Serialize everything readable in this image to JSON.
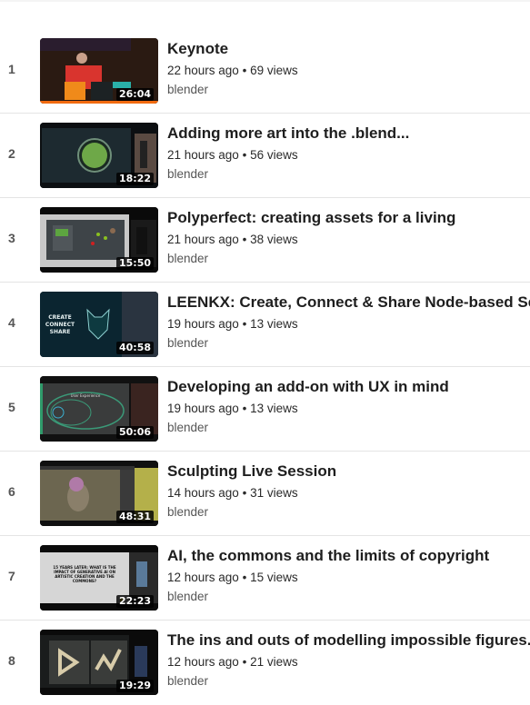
{
  "accent_color": "#f26b10",
  "separator": "•",
  "videos": [
    {
      "index": "1",
      "title": "Keynote",
      "age": "22 hours ago",
      "views": "69 views",
      "channel": "blender",
      "duration": "26:04",
      "watched_fraction": 1.0,
      "thumb": "keynote"
    },
    {
      "index": "2",
      "title": "Adding more art into the .blend...",
      "age": "21 hours ago",
      "views": "56 views",
      "channel": "blender",
      "duration": "18:22",
      "watched_fraction": 0,
      "thumb": "art"
    },
    {
      "index": "3",
      "title": "Polyperfect: creating assets for a living",
      "age": "21 hours ago",
      "views": "38 views",
      "channel": "blender",
      "duration": "15:50",
      "watched_fraction": 0,
      "thumb": "poly"
    },
    {
      "index": "4",
      "title": "LEENKX: Create, Connect & Share Node-based Server",
      "age": "19 hours ago",
      "views": "13 views",
      "channel": "blender",
      "duration": "40:58",
      "watched_fraction": 0,
      "thumb": "leenkx",
      "thumb_text": [
        "CREATE",
        "CONNECT",
        "SHARE"
      ]
    },
    {
      "index": "5",
      "title": "Developing an add-on with UX in mind",
      "age": "19 hours ago",
      "views": "13 views",
      "channel": "blender",
      "duration": "50:06",
      "watched_fraction": 0,
      "thumb": "ux",
      "thumb_text": [
        "User Experience"
      ]
    },
    {
      "index": "6",
      "title": "Sculpting Live Session",
      "age": "14 hours ago",
      "views": "31 views",
      "channel": "blender",
      "duration": "48:31",
      "watched_fraction": 0,
      "thumb": "sculpt"
    },
    {
      "index": "7",
      "title": "AI, the commons and the limits of copyright",
      "age": "12 hours ago",
      "views": "15 views",
      "channel": "blender",
      "duration": "22:23",
      "watched_fraction": 0,
      "thumb": "ai",
      "thumb_text": [
        "15 YEARS LATER: WHAT IS THE",
        "IMPACT OF GENERATIVE AI ON",
        "ARTISTIC CREATION AND THE",
        "COMMONS?"
      ]
    },
    {
      "index": "8",
      "title": "The ins and outs of modelling impossible figures.",
      "age": "12 hours ago",
      "views": "21 views",
      "channel": "blender",
      "duration": "19:29",
      "watched_fraction": 0,
      "thumb": "figures"
    }
  ]
}
